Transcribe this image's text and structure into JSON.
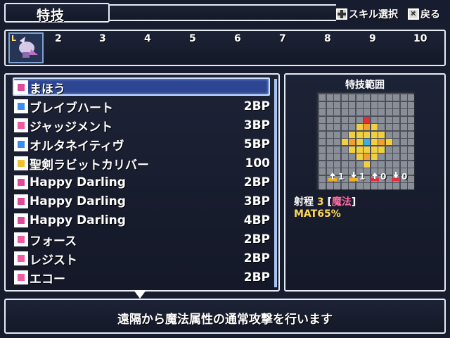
{
  "header": {
    "title": "特技",
    "hint_skill_select": "スキル選択",
    "hint_back": "戻る"
  },
  "char_bar": {
    "level_badge": "L",
    "slots": [
      "2",
      "3",
      "4",
      "5",
      "6",
      "7",
      "8",
      "9",
      "10"
    ]
  },
  "skills": [
    {
      "name": "まほう",
      "cost": "",
      "icon": "magic-category-icon",
      "color": "#e04a9a"
    },
    {
      "name": "ブレイブハート",
      "cost": "2BP",
      "icon": "blue-square-icon",
      "color": "#3a8ef0"
    },
    {
      "name": "ジャッジメント",
      "cost": "3BP",
      "icon": "pink-square-icon",
      "color": "#f05aa0"
    },
    {
      "name": "オルタネイティヴ",
      "cost": "5BP",
      "icon": "blue-square-icon",
      "color": "#3a8ef0"
    },
    {
      "name": "聖剣ラビットカリバー",
      "cost": "100",
      "icon": "holy-sword-icon",
      "color": "#f0c030"
    },
    {
      "name": "Happy Darling",
      "cost": "2BP",
      "icon": "music-note-icon",
      "color": "#e04a9a"
    },
    {
      "name": "Happy Darling",
      "cost": "3BP",
      "icon": "music-note-plus1-icon",
      "color": "#e04a9a"
    },
    {
      "name": "Happy Darling",
      "cost": "4BP",
      "icon": "music-note-plus2-icon",
      "color": "#e04a9a"
    },
    {
      "name": "フォース",
      "cost": "2BP",
      "icon": "vo-icon",
      "color": "#f05aa0"
    },
    {
      "name": "レジスト",
      "cost": "2BP",
      "icon": "vo-icon",
      "color": "#f05aa0"
    },
    {
      "name": "エコー",
      "cost": "2BP",
      "icon": "vo-icon",
      "color": "#f05aa0"
    }
  ],
  "range": {
    "title": "特技範囲",
    "legend": [
      "1",
      "1",
      "0",
      "0"
    ],
    "range_label": "射程",
    "range_value": "3",
    "range_type_open": "[",
    "range_type": "魔法",
    "range_type_close": "]",
    "mat": "MAT65%"
  },
  "description": "遠隔から魔法属性の通常攻撃を行います"
}
